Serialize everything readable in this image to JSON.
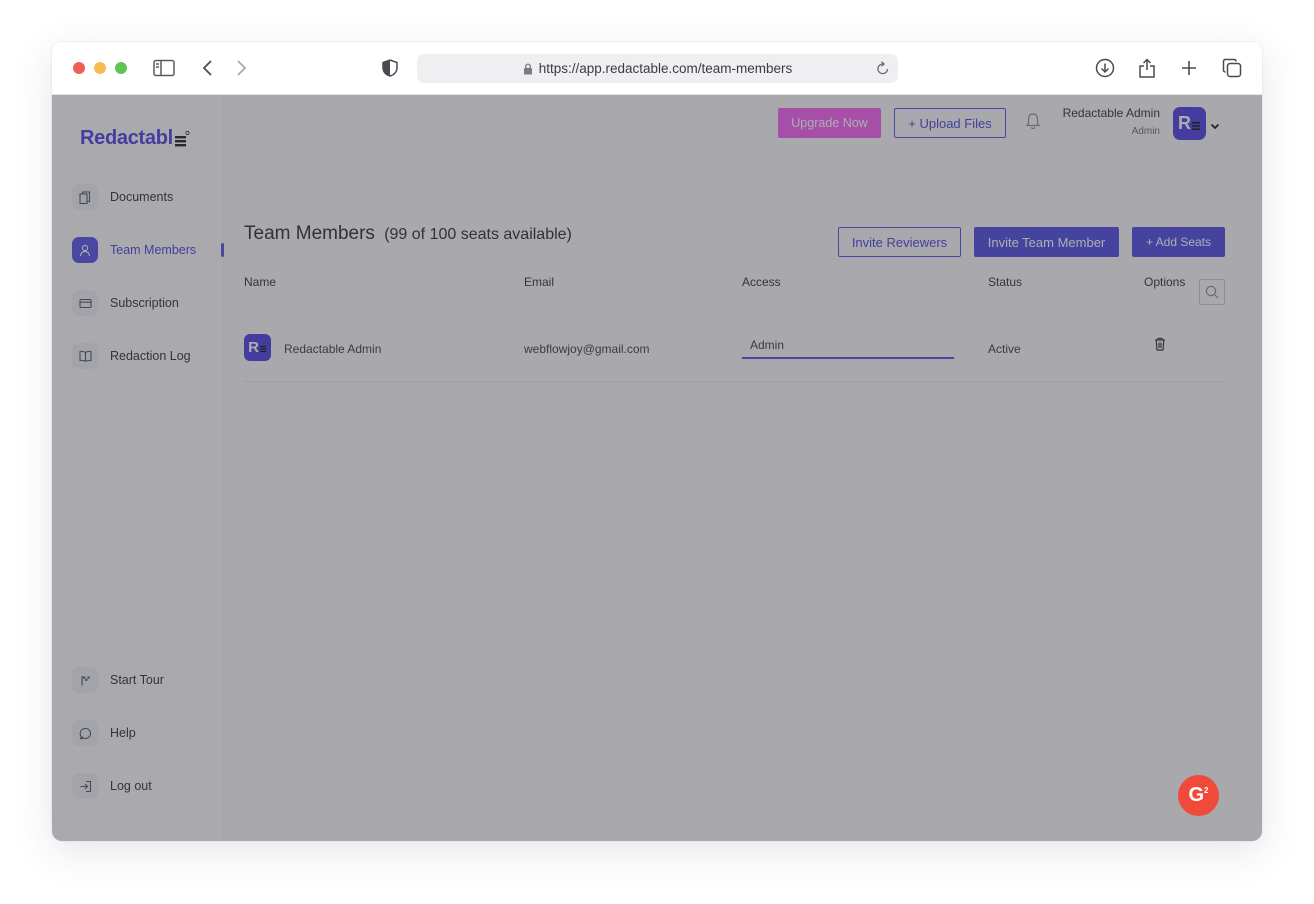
{
  "browser": {
    "url": "https://app.redactable.com/team-members"
  },
  "sidebar": {
    "logo": "Redactabl",
    "items": [
      {
        "label": "Documents",
        "icon": "document-icon"
      },
      {
        "label": "Team Members",
        "icon": "user-icon",
        "active": true
      },
      {
        "label": "Subscription",
        "icon": "card-icon"
      },
      {
        "label": "Redaction Log",
        "icon": "book-icon"
      }
    ],
    "bottom_items": [
      {
        "label": "Start Tour",
        "icon": "flag-icon"
      },
      {
        "label": "Help",
        "icon": "chat-icon"
      },
      {
        "label": "Log out",
        "icon": "logout-icon"
      }
    ]
  },
  "header": {
    "upgrade_label": "Upgrade Now",
    "upload_label": "+ Upload Files",
    "user_name": "Redactable Admin",
    "user_role": "Admin",
    "avatar_letter": "R"
  },
  "main": {
    "title": "Team Members",
    "seats": "(99 of 100 seats available)",
    "invite_reviewers_label": "Invite Reviewers",
    "invite_member_label": "Invite Team Member",
    "add_seats_label": "+ Add Seats",
    "columns": [
      "Name",
      "Email",
      "Access",
      "Status",
      "Options"
    ],
    "rows": [
      {
        "name": "Redactable Admin",
        "email": "webflowjoy@gmail.com",
        "access": "Admin",
        "status": "Active"
      }
    ]
  },
  "g2_badge": {
    "label": "G",
    "sup": "2"
  },
  "colors": {
    "accent": "#5450e6",
    "upgrade": "#f25ef0",
    "g2": "#ef4a3a",
    "overlay": "rgba(60,60,68,0.42)"
  }
}
